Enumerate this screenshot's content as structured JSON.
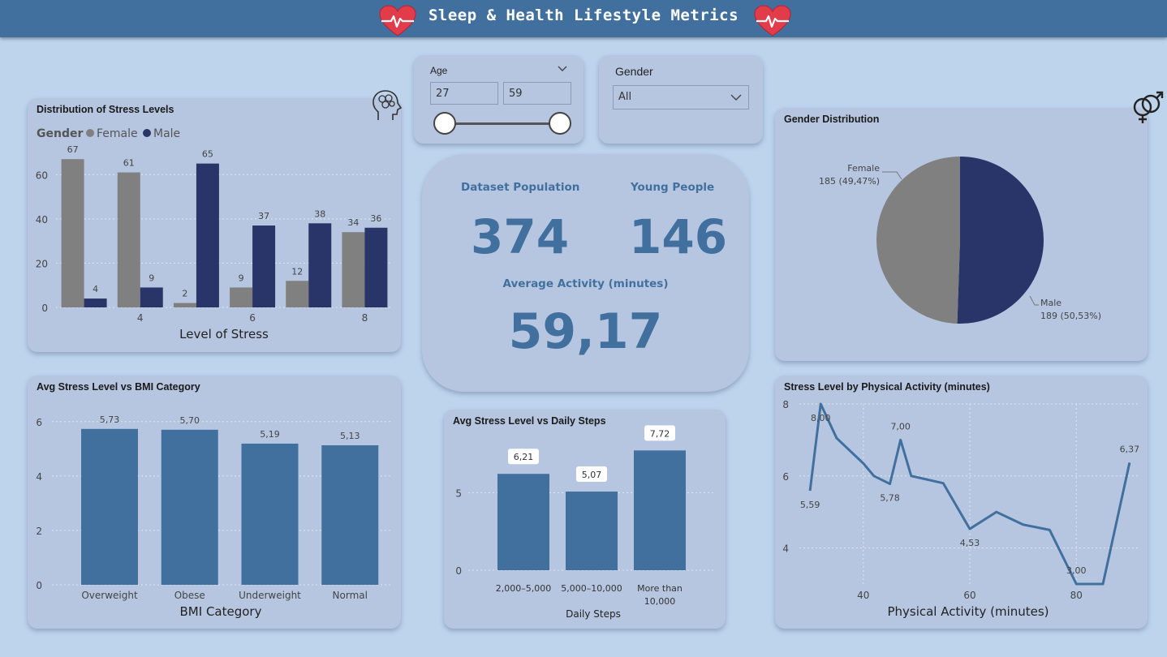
{
  "header": {
    "title": "Sleep & Health Lifestyle Metrics"
  },
  "colors": {
    "female": "#808080",
    "male": "#293468",
    "bar": "#42709e",
    "kpi": "#42709e",
    "header": "#42709e"
  },
  "filters": {
    "age": {
      "label": "Age",
      "min": "27",
      "max": "59"
    },
    "gender": {
      "label": "Gender",
      "selected": "All"
    }
  },
  "kpis": {
    "population_label": "Dataset Population",
    "population_value": "374",
    "young_label": "Young People",
    "young_value": "146",
    "activity_label": "Average Activity (minutes)",
    "activity_value": "59,17"
  },
  "chart_data": [
    {
      "id": "stress",
      "type": "bar",
      "title": "Distribution of Stress Levels",
      "legend_title": "Gender",
      "legend_placement": "top-left",
      "xlabel": "Level of Stress",
      "x": [
        3,
        4,
        5,
        6,
        7,
        8
      ],
      "x_tick_labels": [
        "4",
        "6",
        "8"
      ],
      "series": [
        {
          "name": "Female",
          "values": [
            67,
            61,
            2,
            9,
            12,
            34
          ],
          "labels": [
            "67",
            "61",
            "2",
            "9",
            "12",
            "34"
          ]
        },
        {
          "name": "Male",
          "values": [
            4,
            9,
            65,
            37,
            38,
            36
          ],
          "labels": [
            "4",
            "9",
            "65",
            "37",
            "38",
            "36"
          ]
        }
      ],
      "ylim": [
        0,
        70
      ],
      "y_ticks": [
        0,
        20,
        40,
        60
      ],
      "grid": true
    },
    {
      "id": "bmi",
      "type": "bar",
      "title": "Avg Stress Level vs BMI Category",
      "xlabel": "BMI Category",
      "categories": [
        "Overweight",
        "Obese",
        "Underweight",
        "Normal"
      ],
      "values": [
        5.73,
        5.7,
        5.19,
        5.13
      ],
      "labels": [
        "5,73",
        "5,70",
        "5,19",
        "5,13"
      ],
      "ylim": [
        0,
        6.5
      ],
      "y_ticks": [
        0,
        2,
        4,
        6
      ],
      "grid": true
    },
    {
      "id": "steps",
      "type": "bar",
      "title": "Avg Stress Level vs Daily Steps",
      "xlabel": "Daily Steps",
      "categories": [
        "2,000–5,000",
        "5,000–10,000",
        "More than 10,000"
      ],
      "category_lines": [
        [
          "2,000–5,000"
        ],
        [
          "5,000–10,000"
        ],
        [
          "More than",
          "10,000"
        ]
      ],
      "values": [
        6.21,
        5.07,
        7.72
      ],
      "labels": [
        "6,21",
        "5,07",
        "7,72"
      ],
      "ylim": [
        0,
        8
      ],
      "y_ticks": [
        0,
        5
      ],
      "grid": true
    },
    {
      "id": "gender",
      "type": "pie",
      "title": "Gender Distribution",
      "slices": [
        {
          "name": "Female",
          "value": 185,
          "label": "185 (49,47%)"
        },
        {
          "name": "Male",
          "value": 189,
          "label": "189 (50,53%)"
        }
      ]
    },
    {
      "id": "activity",
      "type": "line",
      "title": "Stress Level by Physical Activity (minutes)",
      "xlabel": "Physical Activity (minutes)",
      "x": [
        30,
        32,
        35,
        40,
        42,
        45,
        47,
        49,
        55,
        60,
        65,
        70,
        75,
        80,
        85,
        90
      ],
      "y": [
        5.59,
        8.0,
        7.05,
        6.35,
        6.0,
        5.78,
        7.0,
        6.0,
        5.8,
        4.53,
        5.0,
        4.65,
        4.5,
        3.0,
        3.0,
        6.37
      ],
      "point_labels": [
        {
          "i": 0,
          "text": "5,59",
          "pos": "below"
        },
        {
          "i": 1,
          "text": "8,00",
          "pos": "below"
        },
        {
          "i": 5,
          "text": "5,78",
          "pos": "below"
        },
        {
          "i": 6,
          "text": "7,00",
          "pos": "above"
        },
        {
          "i": 9,
          "text": "4,53",
          "pos": "below"
        },
        {
          "i": 13,
          "text": "3,00",
          "pos": "above"
        },
        {
          "i": 15,
          "text": "6,37",
          "pos": "above"
        }
      ],
      "xlim": [
        28,
        92
      ],
      "ylim": [
        3,
        8
      ],
      "x_ticks": [
        40,
        60,
        80
      ],
      "y_ticks": [
        4,
        6,
        8
      ],
      "grid": true
    }
  ]
}
